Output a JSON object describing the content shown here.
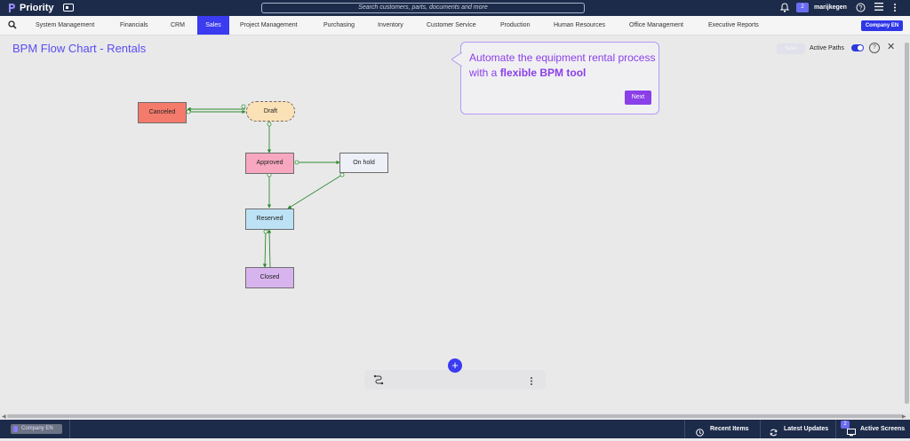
{
  "app": {
    "name": "Priority"
  },
  "topbar": {
    "search_placeholder": "Search customers, parts, documents and more",
    "notification_count": "2",
    "username": "marijkegen"
  },
  "menu": {
    "items": [
      {
        "label": "System Management"
      },
      {
        "label": "Financials"
      },
      {
        "label": "CRM"
      },
      {
        "label": "Sales",
        "active": true
      },
      {
        "label": "Project Management"
      },
      {
        "label": "Purchasing"
      },
      {
        "label": "Inventory"
      },
      {
        "label": "Customer Service"
      },
      {
        "label": "Production"
      },
      {
        "label": "Human Resources"
      },
      {
        "label": "Office Management"
      },
      {
        "label": "Executive Reports"
      }
    ],
    "company_button": "Company EN"
  },
  "page": {
    "title": "BPM Flow Chart - Rentals",
    "save_label": "Save",
    "active_paths_label": "Active Paths",
    "active_paths_on": true
  },
  "flowchart": {
    "nodes": [
      {
        "id": "canceled",
        "label": "Canceled",
        "color": "#f47a6b"
      },
      {
        "id": "draft",
        "label": "Draft",
        "color": "#fbe1b6"
      },
      {
        "id": "approved",
        "label": "Approved",
        "color": "#f7a8c0"
      },
      {
        "id": "onhold",
        "label": "On hold",
        "color": "#eef0f8"
      },
      {
        "id": "reserved",
        "label": "Reserved",
        "color": "#bde2f5"
      },
      {
        "id": "closed",
        "label": "Closed",
        "color": "#d8b4ef"
      }
    ],
    "edge_color": "#2e8a2e"
  },
  "tooltip": {
    "text_plain": "Automate the equipment rental process with a ",
    "text_bold": "flexible BPM tool",
    "next_label": "Next"
  },
  "statusbar": {
    "company": "Company EN",
    "recent_items": "Recent Items",
    "latest_updates": "Latest Updates",
    "active_screens": "Active Screens",
    "active_screens_count": "2"
  },
  "colors": {
    "accent": "#3b3bf0",
    "topbar": "#1d2b4a",
    "tooltip_accent": "#8a3fe8"
  }
}
